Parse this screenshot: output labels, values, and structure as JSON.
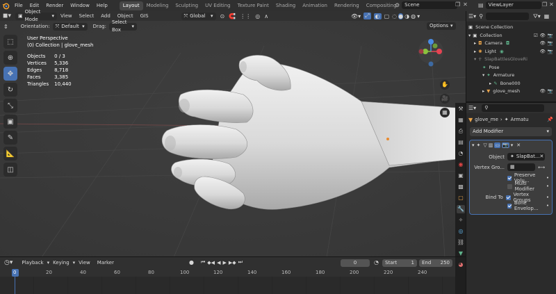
{
  "menu": [
    "File",
    "Edit",
    "Render",
    "Window",
    "Help"
  ],
  "workspaces": [
    {
      "label": "Layout",
      "active": true
    },
    {
      "label": "Modeling"
    },
    {
      "label": "Sculpting"
    },
    {
      "label": "UV Editing"
    },
    {
      "label": "Texture Paint"
    },
    {
      "label": "Shading"
    },
    {
      "label": "Animation"
    },
    {
      "label": "Rendering"
    },
    {
      "label": "Compositing"
    },
    {
      "label": "Geometry Noc"
    }
  ],
  "scene": "Scene",
  "view_layer": "ViewLayer",
  "viewport_header": {
    "mode": "Object Mode",
    "menus": [
      "View",
      "Select",
      "Add",
      "Object",
      "GIS"
    ],
    "transform": "Global"
  },
  "tool_settings": {
    "orientation_label": "Orientation:",
    "orientation_value": "Default",
    "drag_label": "Drag:",
    "drag_value": "Select Box",
    "options": "Options"
  },
  "overlay": {
    "view_name": "User Perspective",
    "context": "(0) Collection | glove_mesh",
    "stats": [
      {
        "label": "Objects",
        "value": "0 / 3"
      },
      {
        "label": "Vertices",
        "value": "5,336"
      },
      {
        "label": "Edges",
        "value": "8,718"
      },
      {
        "label": "Faces",
        "value": "3,385"
      },
      {
        "label": "Triangles",
        "value": "10,440"
      }
    ]
  },
  "gizmo_axes": {
    "x_color": "#e54452",
    "y_color": "#8bc13e",
    "z_color": "#4a8de5"
  },
  "timeline": {
    "menus": [
      "Playback",
      "Keying",
      "View",
      "Marker"
    ],
    "current_frame": "0",
    "start_label": "Start",
    "start": "1",
    "end_label": "End",
    "end": "250",
    "ticks": [
      "0",
      "20",
      "40",
      "60",
      "80",
      "100",
      "120",
      "140",
      "160",
      "180",
      "200",
      "220",
      "240"
    ]
  },
  "outliner": {
    "search_placeholder": "",
    "items": [
      {
        "label": "Scene Collection",
        "indent": 0,
        "icon": "scene-collection-icon"
      },
      {
        "label": "Collection",
        "indent": 1,
        "icon": "collection-icon"
      },
      {
        "label": "Camera",
        "indent": 2,
        "icon": "camera-icon"
      },
      {
        "label": "Light",
        "indent": 2,
        "icon": "light-icon"
      },
      {
        "label": "SlapBattlesGloveRi",
        "indent": 2,
        "icon": "armature-icon"
      },
      {
        "label": "Pose",
        "indent": 3,
        "icon": "pose-icon"
      },
      {
        "label": "Armature",
        "indent": 3,
        "icon": "armature-data-icon"
      },
      {
        "label": "Bone000",
        "indent": 4,
        "icon": "bone-icon"
      },
      {
        "label": "glove_mesh",
        "indent": 2,
        "icon": "mesh-icon"
      }
    ]
  },
  "properties": {
    "breadcrumb_object": "glove_me",
    "breadcrumb_modifier": "Armatu",
    "add_modifier": "Add Modifier",
    "object_label": "Object",
    "object_value": "SlapBat...",
    "vertex_group_label": "Vertex Gro...",
    "preserve_volume": "Preserve Volu...",
    "multi_modifier": "Multi Modifier",
    "bind_to_label": "Bind To",
    "vertex_groups": "Vertex Groups",
    "bone_envelopes": "Bone Envelop..."
  }
}
